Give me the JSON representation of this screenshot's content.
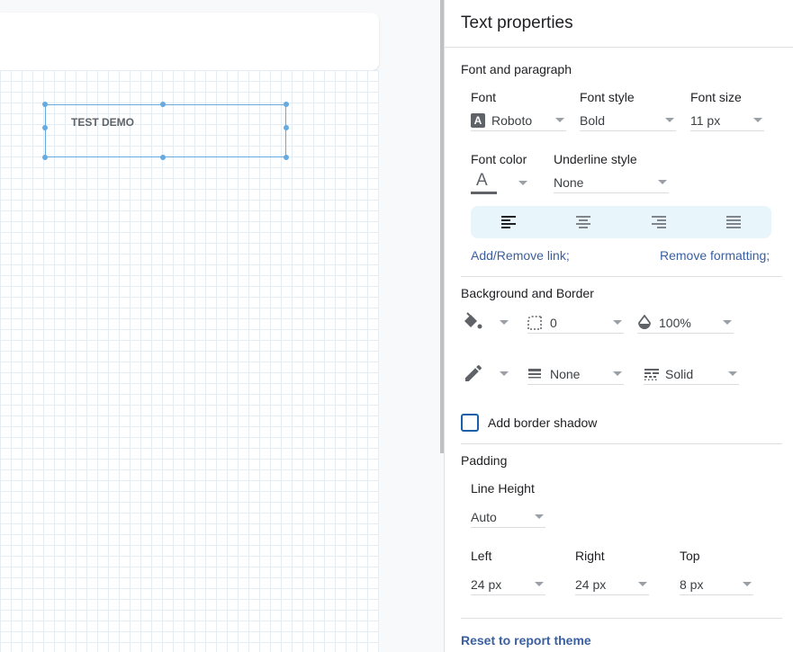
{
  "canvas": {
    "text_box_label": "TEST DEMO"
  },
  "panel": {
    "title": "Text properties",
    "font_paragraph": {
      "section_title": "Font and paragraph",
      "font_label": "Font",
      "font_value": "Roboto",
      "font_style_label": "Font style",
      "font_style_value": "Bold",
      "font_size_label": "Font size",
      "font_size_value": "11 px",
      "font_color_label": "Font color",
      "underline_label": "Underline style",
      "underline_value": "None",
      "add_remove_link": "Add/Remove link;",
      "remove_formatting": "Remove formatting;"
    },
    "background_border": {
      "section_title": "Background and Border",
      "radius_value": "0",
      "opacity_value": "100%",
      "border_weight_value": "None",
      "border_style_value": "Solid",
      "shadow_label": "Add border shadow"
    },
    "padding": {
      "section_title": "Padding",
      "line_height_label": "Line Height",
      "line_height_value": "Auto",
      "left_label": "Left",
      "left_value": "24 px",
      "right_label": "Right",
      "right_value": "24 px",
      "top_label": "Top",
      "top_value": "8 px"
    },
    "reset_link": "Reset to report theme"
  },
  "colors": {
    "accent": "#3a5fa0",
    "selection": "#66aadf",
    "align_bar_bg": "#e8f5fb"
  },
  "icons": [
    "font-icon",
    "font-color-icon",
    "align-left-icon",
    "align-center-icon",
    "align-right-icon",
    "align-justify-icon",
    "fill-bucket-icon",
    "border-radius-icon",
    "opacity-drop-icon",
    "pencil-icon",
    "line-weight-icon",
    "line-style-icon"
  ]
}
